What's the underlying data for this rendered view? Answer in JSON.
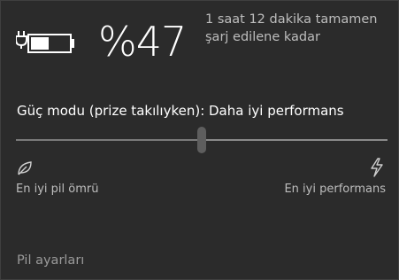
{
  "battery": {
    "percent_text": "%47",
    "level": 0.47,
    "charging": true,
    "time_text": "1 saat 12 dakika tamamen şarj edilene kadar"
  },
  "power_mode": {
    "label": "Güç modu (prize takılıyken): Daha iyi performans",
    "slider_level": 0.5,
    "min_label": "En iyi pil ömrü",
    "max_label": "En iyi performans",
    "min_icon": "leaf-icon",
    "max_icon": "lightning-icon"
  },
  "footer": {
    "settings_link": "Pil ayarları"
  },
  "colors": {
    "background": "#2b2b2b",
    "primary_text": "#ffffff",
    "secondary_text": "#bdbdbd",
    "link_text": "#9a9a9a"
  }
}
